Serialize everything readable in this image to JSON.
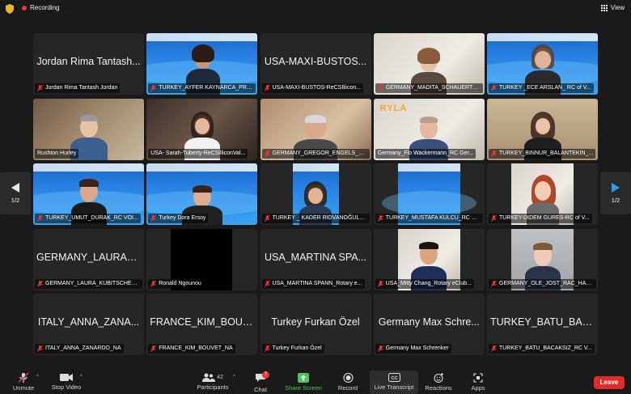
{
  "topbar": {
    "recording_label": "Recording",
    "view_label": "View"
  },
  "tiles": [
    {
      "big_name": "Jordan Rima Tantash...",
      "name": "Jordan Rima Tantash Jordan"
    },
    {
      "big_name": "",
      "name": "TURKEY_AYFER KAYNARCA_PRE..."
    },
    {
      "big_name": "USA-MAXI-BUSTOS...",
      "name": "USA-MAXI-BUSTOS-ReCSIliicon..."
    },
    {
      "big_name": "",
      "name": "GERMANY_MADITA_SCHAUERTE..."
    },
    {
      "big_name": "",
      "name": "TURKEY _ECE ARSLAN_ RC of V..."
    },
    {
      "big_name": "",
      "name": "Rushton Hurley"
    },
    {
      "big_name": "",
      "name": "USA- Sarah-Tuberty-ReCSilliconVal..."
    },
    {
      "big_name": "",
      "name": "GERMANY_GREGOR_ENGELS_R..."
    },
    {
      "big_name": "",
      "name": "Germany_Flo Wackermann_RC Ger..."
    },
    {
      "big_name": "",
      "name": "TURKEY_BINNUR_BALANTEKIN_..."
    },
    {
      "big_name": "",
      "name": "TURKEY_UMUT_DURAK_RC VOI..."
    },
    {
      "big_name": "",
      "name": "Turkey Dora Ersoy"
    },
    {
      "big_name": "",
      "name": "TURKEY _ KADER RIDVANOĞULLA..."
    },
    {
      "big_name": "",
      "name": "TURKEY_MUSTAFA KULCU_RC O..."
    },
    {
      "big_name": "",
      "name": "TURKEY-DIDEM GURES-RC of V..."
    },
    {
      "big_name": "GERMANY_LAURA_...",
      "name": "GERMANY_LAURA_KUBITSCHEC..."
    },
    {
      "big_name": "",
      "name": "Ronald Ngounou"
    },
    {
      "big_name": "USA_MARTINA SPA...",
      "name": "USA_MARTINA SPANN_Rotary e..."
    },
    {
      "big_name": "",
      "name": "USA_Mitty Chang_Rotary eClub..."
    },
    {
      "big_name": "",
      "name": "GERMANY_OLE_JOST_RAC_HAM..."
    },
    {
      "big_name": "ITALY_ANNA_ZANA...",
      "name": "ITALY_ANNA_ZANARDO_NA"
    },
    {
      "big_name": "FRANCE_KIM_BOUV...",
      "name": "FRANCE_KIM_BOUVET_NA"
    },
    {
      "big_name": "Turkey Furkan Özel",
      "name": "Turkey Furkan Özel"
    },
    {
      "big_name": "Germany Max Schre...",
      "name": "Germany Max Schrenker"
    },
    {
      "big_name": "TURKEY_BATU_BAC...",
      "name": "TURKEY_BATU_BACAKSIZ_RC V..."
    }
  ],
  "ryla_logo": {
    "letters": "RY",
    "accent": "LA"
  },
  "pager": {
    "left_label": "1/2",
    "right_label": "1/2"
  },
  "toolbar": {
    "unmute": "Unmute",
    "stop_video": "Stop Video",
    "participants": "Participants",
    "participants_count": "42",
    "chat": "Chat",
    "chat_badge": "7",
    "share_screen": "Share Screen",
    "record": "Record",
    "live_transcript": "Live Transcript",
    "reactions": "Reactions",
    "apps": "Apps",
    "leave": "Leave"
  },
  "colors": {
    "accent_green": "#4fc25a",
    "leave_red": "#e02b2b",
    "recording_red": "#e5383b"
  }
}
